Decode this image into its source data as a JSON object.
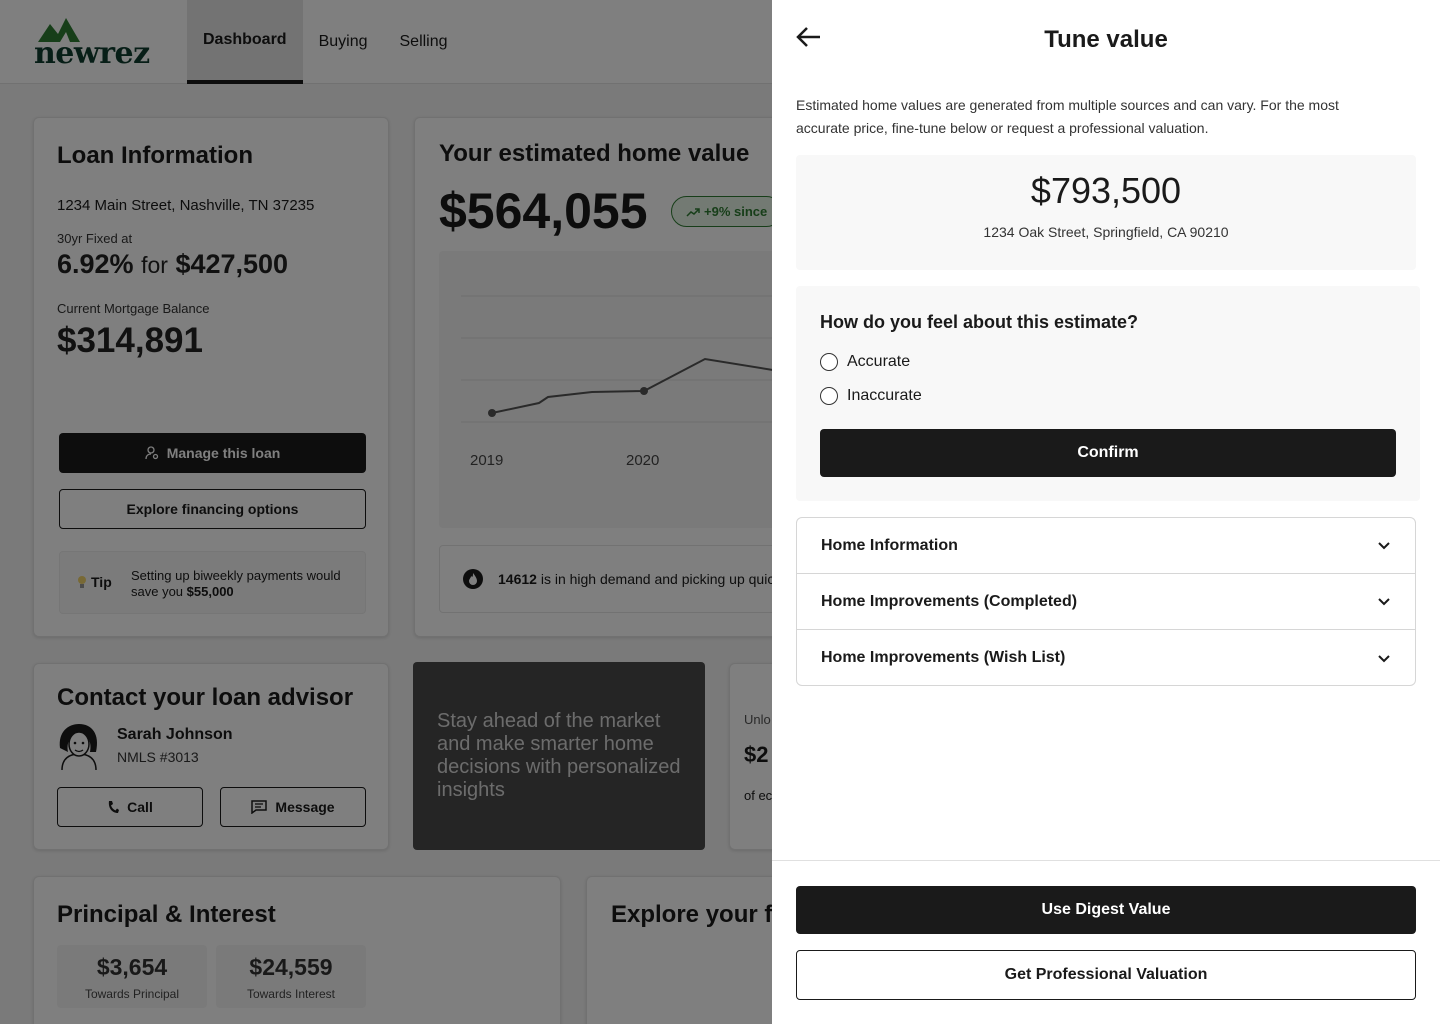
{
  "brand": {
    "name": "newrez",
    "accent": "#2e7d32",
    "dark": "#1a1a1a"
  },
  "nav": {
    "tabs": [
      {
        "label": "Dashboard",
        "active": true
      },
      {
        "label": "Buying"
      },
      {
        "label": "Selling"
      }
    ]
  },
  "loan": {
    "title": "Loan Information",
    "address": "1234 Main Street, Nashville, TN 37235",
    "rate_label": "30yr Fixed at",
    "rate": "6.92%",
    "rate_for": "for",
    "amount": "$427,500",
    "balance_label": "Current Mortgage Balance",
    "balance": "$314,891",
    "manage_label": "Manage this loan",
    "explore_label": "Explore financing options",
    "tip_label": "Tip",
    "tip_text": "Setting up biweekly payments would save you",
    "tip_amount": "$55,000"
  },
  "home": {
    "title": "Your estimated home value",
    "value": "$564,055",
    "badge": "+9% since",
    "chart_years": [
      "2019",
      "2020"
    ],
    "demand_zip": "14612",
    "demand_text": "is in high demand and picking up quickly"
  },
  "advisor": {
    "title": "Contact your loan advisor",
    "name": "Sarah Johnson",
    "nmls": "NMLS #3013",
    "call_label": "Call",
    "message_label": "Message"
  },
  "promo": {
    "text": "Stay ahead of the market and make smarter home decisions with personalized insights"
  },
  "equity": {
    "label": "Unlo",
    "amount": "$2",
    "sub": "of ec"
  },
  "principal": {
    "title": "Principal & Interest",
    "stats": [
      {
        "value": "$3,654",
        "label": "Towards Principal"
      },
      {
        "value": "$24,559",
        "label": "Towards Interest"
      }
    ]
  },
  "explore": {
    "title": "Explore your f"
  },
  "drawer": {
    "title": "Tune value",
    "description": "Estimated home values are generated from multiple sources and can vary. For the most accurate price, fine-tune below or request a professional valuation.",
    "estimate": "$793,500",
    "estimate_address": "1234 Oak Street, Springfield, CA 90210",
    "question": "How do you feel about this estimate?",
    "options": [
      {
        "label": "Accurate",
        "selected": false
      },
      {
        "label": "Inaccurate",
        "selected": false
      }
    ],
    "confirm_label": "Confirm",
    "sections": [
      {
        "label": "Home Information"
      },
      {
        "label": "Home Improvements (Completed)"
      },
      {
        "label": "Home Improvements (Wish List)"
      }
    ],
    "use_digest_label": "Use Digest Value",
    "professional_label": "Get Professional Valuation"
  }
}
